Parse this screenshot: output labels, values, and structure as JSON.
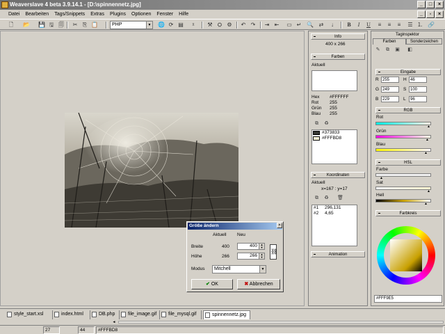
{
  "window": {
    "title": "Weaverslave 4 beta 3.9.14.1 - [D:\\spinnennetz.jpg]"
  },
  "menu": [
    "Datei",
    "Bearbeiten",
    "Tags/Snippets",
    "Extras",
    "Plugins",
    "Optionen",
    "Fenster",
    "Hilfe"
  ],
  "toolbar": {
    "language_combo": "PHP"
  },
  "info_panel": {
    "header": "Info",
    "size": "400 x 266"
  },
  "farben_panel": {
    "header": "Farben",
    "current_label": "Aktuell",
    "hex_label": "Hex",
    "hex_value": "#FFFFFF",
    "rot_label": "Rot",
    "rot_value": "255",
    "gruen_label": "Grün",
    "gruen_value": "255",
    "blau_label": "Blau",
    "blau_value": "255",
    "swatches": [
      {
        "hex": "#373833",
        "label": "#373833"
      },
      {
        "hex": "#FFFBD8",
        "label": "#FFFBD8"
      }
    ]
  },
  "koordinaten_panel": {
    "header": "Koordinaten",
    "current_label": "Aktuell",
    "current_value": "x=167 : y=17",
    "points": [
      {
        "num": "#1",
        "value": "296,131"
      },
      {
        "num": "#2",
        "value": "4,65"
      }
    ]
  },
  "animation_panel": {
    "header": "Animation"
  },
  "taginspektor": {
    "title": "Taginspektor",
    "tab_farben": "Farben",
    "tab_sonderzeichen": "Sonderzeichen",
    "eingabe_header": "Eingabe",
    "inputs": [
      {
        "label": "R",
        "value": "255"
      },
      {
        "label": "H",
        "value": "46"
      },
      {
        "label": "G",
        "value": "249"
      },
      {
        "label": "S",
        "value": "100"
      },
      {
        "label": "B",
        "value": "229"
      },
      {
        "label": "L",
        "value": "96"
      }
    ],
    "rgb_header": "RGB",
    "rot_label": "Rot",
    "gruen_label": "Grün",
    "blau_label": "Blau",
    "hsl_header": "HSL",
    "farbe_label": "Farbe",
    "sat_label": "Sat",
    "hell_label": "Hell",
    "farbkreis_header": "Farbkreis",
    "hex_output": "#FFF9E5"
  },
  "dialog": {
    "title": "Größe ändern",
    "col_aktuell": "Aktuell",
    "col_neu": "Neu",
    "breite_label": "Breite",
    "breite_aktuell": "400",
    "breite_neu": "400",
    "hoehe_label": "Höhe",
    "hoehe_aktuell": "266",
    "hoehe_neu": "266",
    "modus_label": "Modus",
    "modus_value": "Mitchell",
    "ok_label": "OK",
    "cancel_label": "Abbrechen"
  },
  "tabs": [
    "style_start.xsl",
    "index.html",
    "DB.php",
    "file_image.gif",
    "file_mysql.gif",
    "spinnennetz.jpg"
  ],
  "active_tab": "spinnennetz.jpg",
  "statusbar": {
    "line": "27",
    "col": "44",
    "color": "#FFFBD8"
  }
}
